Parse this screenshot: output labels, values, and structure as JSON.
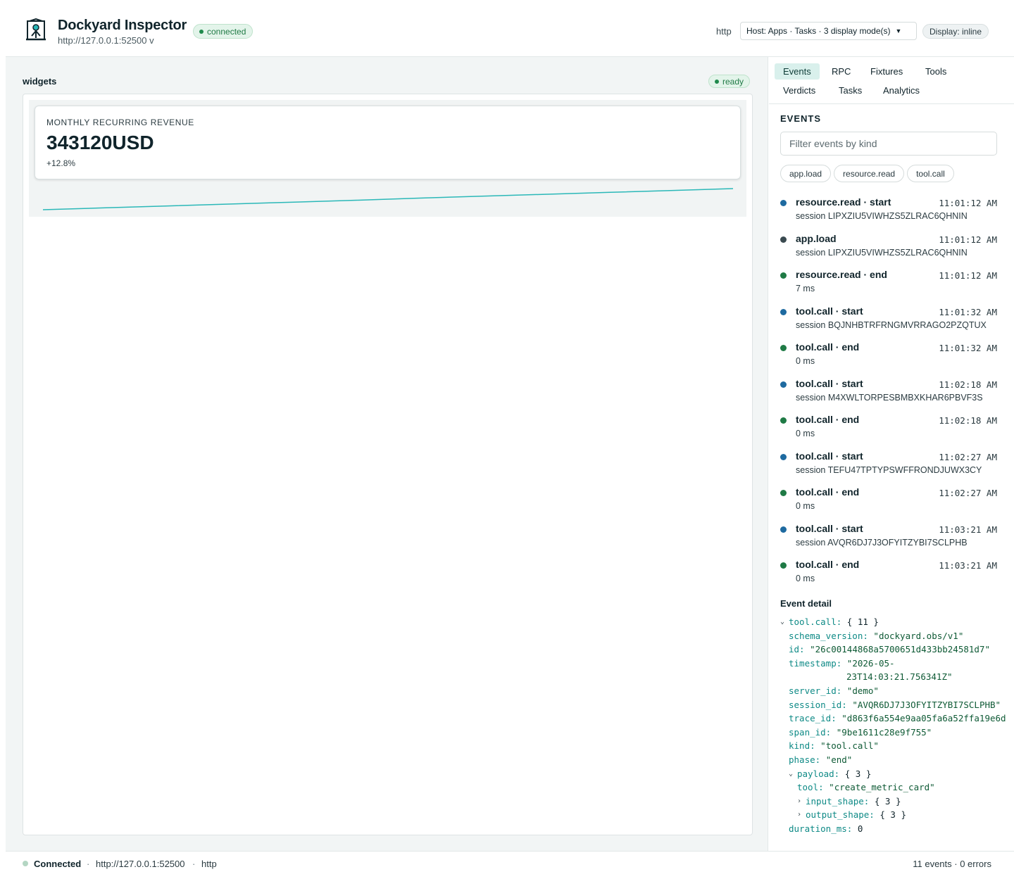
{
  "header": {
    "title": "Dockyard Inspector",
    "url": "http://127.0.0.1:52500 v",
    "status": "connected",
    "transport": "http",
    "host_select": "Host: Apps · Tasks · 3 display mode(s)",
    "display": "Display: inline"
  },
  "main": {
    "panel_label": "widgets",
    "panel_status": "ready",
    "metric_card": {
      "label": "MONTHLY RECURRING REVENUE",
      "value": "343120USD",
      "delta": "+12.8%"
    }
  },
  "sidebar": {
    "tabs": [
      {
        "label": "Events",
        "active": true
      },
      {
        "label": "RPC"
      },
      {
        "label": "Fixtures"
      },
      {
        "label": "Tools"
      },
      {
        "label": "Verdicts"
      },
      {
        "label": "Tasks"
      },
      {
        "label": "Analytics"
      }
    ],
    "events_heading": "EVENTS",
    "filter_placeholder": "Filter events by kind",
    "filter_chips": [
      "app.load",
      "resource.read",
      "tool.call"
    ],
    "events": [
      {
        "title": "resource.read · start",
        "time": "11:01:12 AM",
        "detail": "session LIPXZIU5VIWHZS5ZLRAC6QHNIN",
        "color": "#1e6aa0"
      },
      {
        "title": "app.load",
        "time": "11:01:12 AM",
        "detail": "session LIPXZIU5VIWHZS5ZLRAC6QHNIN",
        "color": "#3a4a50"
      },
      {
        "title": "resource.read · end",
        "time": "11:01:12 AM",
        "detail": "7 ms",
        "color": "#1f7a45"
      },
      {
        "title": "tool.call · start",
        "time": "11:01:32 AM",
        "detail": "session BQJNHBTRFRNGMVRRAGO2PZQTUX",
        "color": "#1e6aa0"
      },
      {
        "title": "tool.call · end",
        "time": "11:01:32 AM",
        "detail": "0 ms",
        "color": "#1f7a45"
      },
      {
        "title": "tool.call · start",
        "time": "11:02:18 AM",
        "detail": "session M4XWLTORPESBMBXKHAR6PBVF3S",
        "color": "#1e6aa0"
      },
      {
        "title": "tool.call · end",
        "time": "11:02:18 AM",
        "detail": "0 ms",
        "color": "#1f7a45"
      },
      {
        "title": "tool.call · start",
        "time": "11:02:27 AM",
        "detail": "session TEFU47TPTYPSWFFRONDJUWX3CY",
        "color": "#1e6aa0"
      },
      {
        "title": "tool.call · end",
        "time": "11:02:27 AM",
        "detail": "0 ms",
        "color": "#1f7a45"
      },
      {
        "title": "tool.call · start",
        "time": "11:03:21 AM",
        "detail": "session AVQR6DJ7J3OFYITZYBI7SCLPHB",
        "color": "#1e6aa0"
      },
      {
        "title": "tool.call · end",
        "time": "11:03:21 AM",
        "detail": "0 ms",
        "color": "#1f7a45"
      }
    ],
    "detail_heading": "Event detail",
    "detail_tree": {
      "root_key": "tool.call:",
      "root_count": "{ 11 }",
      "schema_version": "\"dockyard.obs/v1\"",
      "id": "\"26c00144868a5700651d433bb24581d7\"",
      "timestamp_1": "\"2026-05-",
      "timestamp_2": "23T14:03:21.756341Z\"",
      "server_id": "\"demo\"",
      "session_id": "\"AVQR6DJ7J3OFYITZYBI7SCLPHB\"",
      "trace_id": "\"d863f6a554e9aa05fa6a52ffa19e6d",
      "span_id": "\"9be1611c28e9f755\"",
      "kind": "\"tool.call\"",
      "phase": "\"end\"",
      "payload_count": "{ 3 }",
      "tool": "\"create_metric_card\"",
      "input_shape_count": "{ 3 }",
      "output_shape_count": "{ 3 }",
      "duration_ms": "0"
    }
  },
  "footer": {
    "status": "Connected",
    "url": "http://127.0.0.1:52500",
    "transport": "http",
    "counts": "11 events · 0 errors"
  },
  "chart_data": {
    "type": "line",
    "values": [
      0.0,
      0.09,
      0.18,
      0.27,
      0.36,
      0.45,
      0.55,
      0.64,
      0.73,
      0.82,
      0.91,
      1.0
    ],
    "color": "#2bb8b8"
  }
}
